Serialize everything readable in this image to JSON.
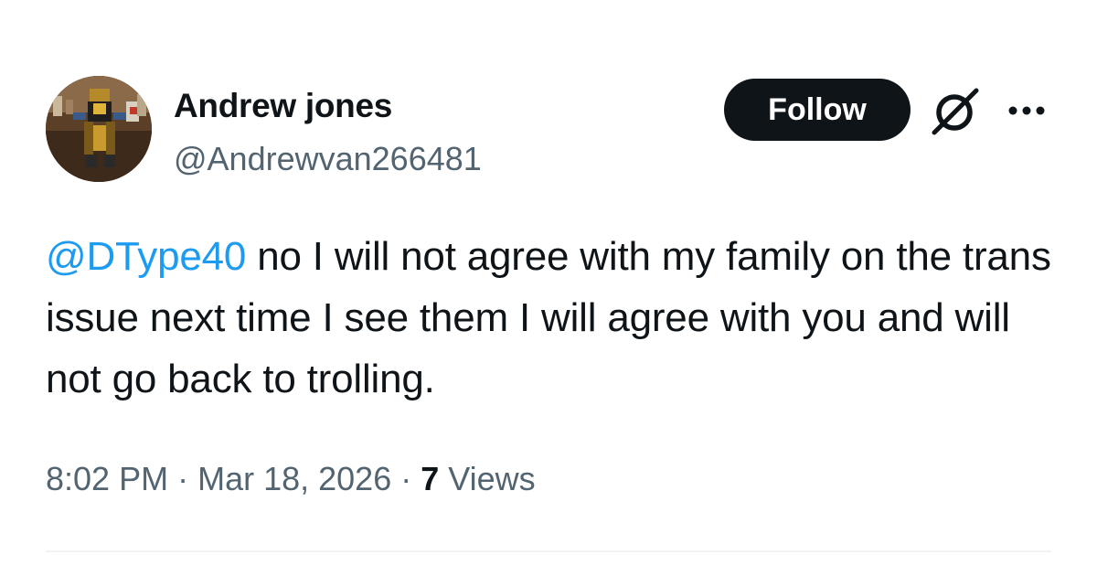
{
  "author": {
    "display_name": "Andrew jones",
    "handle": "@Andrewvan266481"
  },
  "actions": {
    "follow_label": "Follow",
    "grok_icon": "grok-icon",
    "more_icon": "more-icon"
  },
  "tweet": {
    "mention": "@DType40",
    "text": " no I will not agree with my family on the trans issue next time I see them I will agree with you and will not go back to trolling."
  },
  "meta": {
    "time": "8:02 PM",
    "sep1": " · ",
    "date": "Mar 18, 2026",
    "sep2": " · ",
    "views_count": "7",
    "views_label": " Views"
  },
  "colors": {
    "link": "#1d9bf0",
    "text": "#0f1419",
    "secondary": "#536471",
    "button_bg": "#0f1419"
  }
}
